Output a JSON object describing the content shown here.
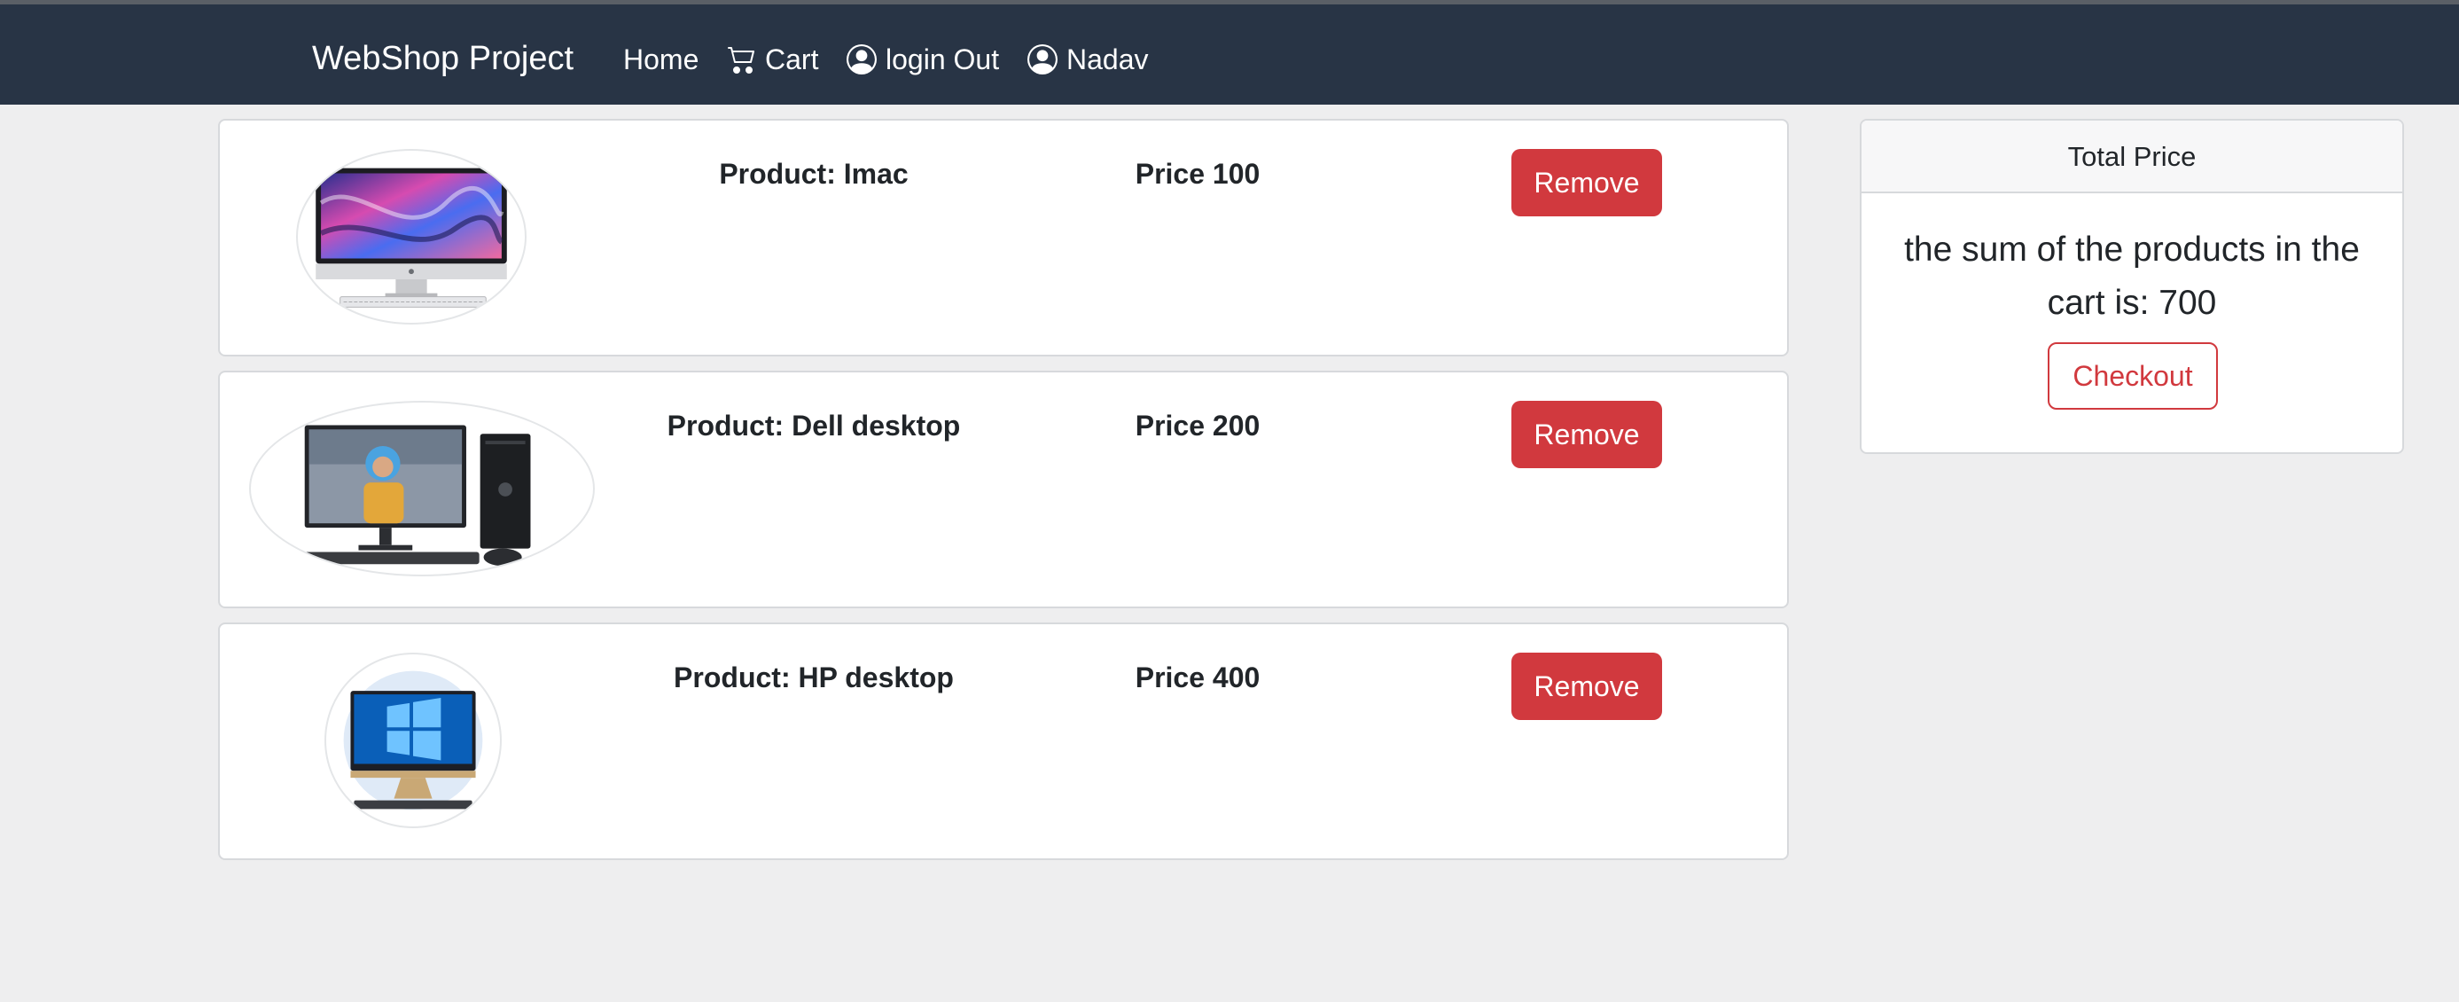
{
  "navbar": {
    "brand": "WebShop Project",
    "links": [
      {
        "label": "Home",
        "icon": ""
      },
      {
        "label": "Cart",
        "icon": "cart-icon"
      },
      {
        "label": "login Out",
        "icon": "user-circle-icon"
      },
      {
        "label": "Nadav",
        "icon": "user-circle-icon"
      }
    ]
  },
  "cart": {
    "items": [
      {
        "name": "Product: Imac",
        "price": "Price 100",
        "remove_label": "Remove"
      },
      {
        "name": "Product: Dell desktop",
        "price": "Price 200",
        "remove_label": "Remove"
      },
      {
        "name": "Product: HP desktop",
        "price": "Price 400",
        "remove_label": "Remove"
      }
    ]
  },
  "summary": {
    "header": "Total Price",
    "text": "the sum of the products in the cart is: 700",
    "checkout_label": "Checkout"
  },
  "colors": {
    "navbar": "#283445",
    "danger": "#d1393e",
    "background": "#eeeeef"
  }
}
